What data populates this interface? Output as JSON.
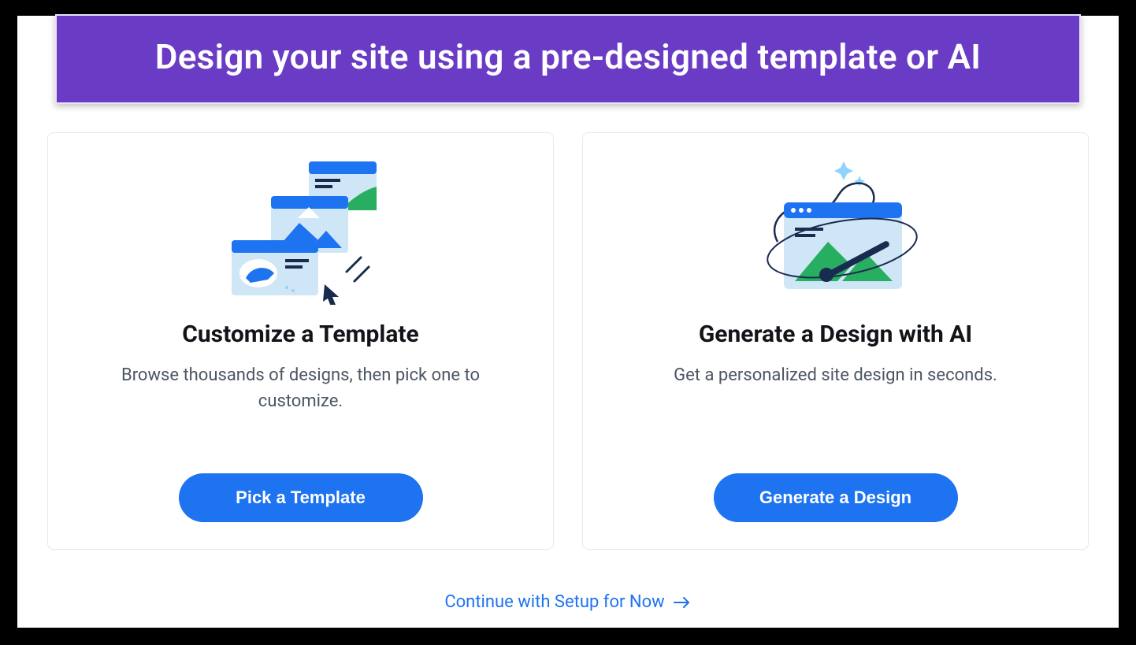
{
  "banner": {
    "title": "Design your site using a pre-designed template or AI"
  },
  "cards": {
    "template": {
      "title": "Customize a Template",
      "description": "Browse thousands of designs, then pick one to customize.",
      "cta_label": "Pick a Template"
    },
    "ai": {
      "title": "Generate a Design with AI",
      "description": "Get a personalized site design in seconds.",
      "cta_label": "Generate a Design"
    }
  },
  "footer": {
    "continue_label": "Continue with Setup for Now"
  },
  "colors": {
    "banner_bg": "#6a3bc4",
    "primary_button": "#1e73f0",
    "link": "#1e73f0"
  }
}
